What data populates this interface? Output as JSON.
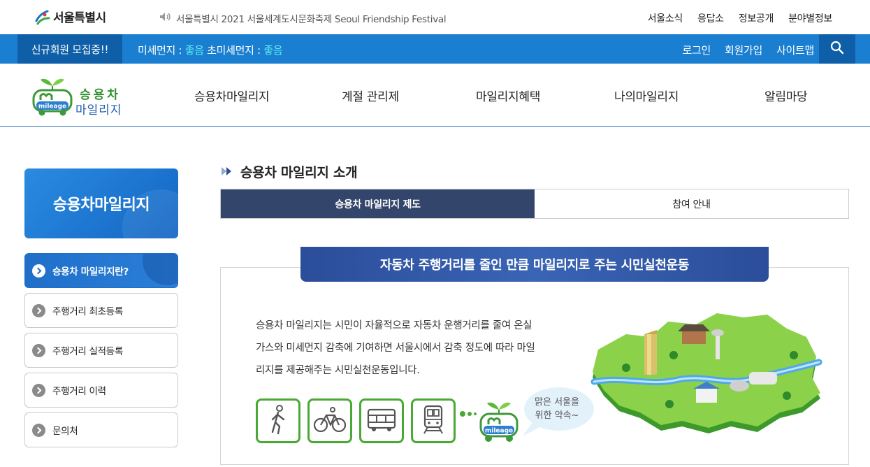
{
  "topbar": {
    "logo_text": "서울특별시",
    "notice": "서울특별시 2021 서울세계도시문화축제 Seoul Friendship Festival",
    "links": [
      "서울소식",
      "응답소",
      "정보공개",
      "분야별정보"
    ]
  },
  "bluebar": {
    "recruit": "신규회원 모집중!!",
    "dust_label": "미세먼지 : ",
    "dust_value": "좋음",
    "fine_dust_label": " 초미세먼지 : ",
    "fine_dust_value": "좋음",
    "user_links": [
      "로그인",
      "회원가입",
      "사이트맵"
    ]
  },
  "brand": {
    "line1": "승용차",
    "line2": "마일리지",
    "badge": "mileage"
  },
  "gnb": [
    "승용차마일리지",
    "계절 관리제",
    "마일리지혜택",
    "나의마일리지",
    "알림마당"
  ],
  "sidebar": {
    "title": "승용차마일리지",
    "items": [
      {
        "label": "승용차 마일리지란?",
        "active": true
      },
      {
        "label": "주행거리 최초등록",
        "active": false
      },
      {
        "label": "주행거리 실적등록",
        "active": false
      },
      {
        "label": "주행거리 이력",
        "active": false
      },
      {
        "label": "문의처",
        "active": false
      }
    ]
  },
  "content": {
    "page_title": "승용차 마일리지 소개",
    "tabs": [
      "승용차 마일리지 제도",
      "참여 안내"
    ],
    "banner": "자동차 주행거리를 줄인 만큼 마일리지로 주는 시민실천운동",
    "description": [
      "승용차 마일리지는 시민이 자율적으로 자동차 운행거리를 줄여 온실",
      "가스와 미세먼지 감축에 기여하면 서울시에서 감축 정도에 따라 마일",
      "리지를 제공해주는 시민실천운동입니다."
    ],
    "icons": [
      "walking-icon",
      "bicycle-icon",
      "bus-icon",
      "subway-icon"
    ],
    "mascot_badge": "mileage",
    "bubble": [
      "맑은 서울을",
      "위한 약속~"
    ]
  },
  "colors": {
    "blue_bar": "#1a7fd1",
    "dark_blue": "#0f5fa8",
    "tab_active": "#34456b",
    "green": "#4aa936",
    "dust_good": "#5ff1f2"
  }
}
